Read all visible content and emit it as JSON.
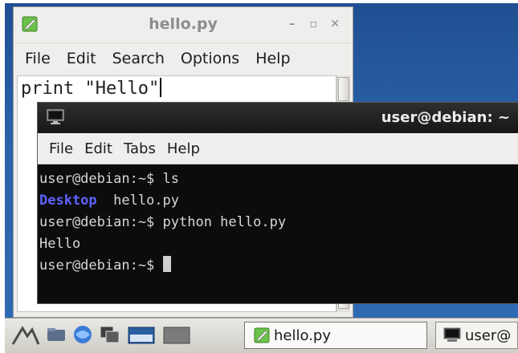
{
  "editor": {
    "title": "hello.py",
    "menu": [
      "File",
      "Edit",
      "Search",
      "Options",
      "Help"
    ],
    "content": "print \"Hello\"",
    "window_buttons": [
      "–",
      "▫",
      "✕"
    ]
  },
  "terminal": {
    "title": "user@debian: ~",
    "menu": [
      "File",
      "Edit",
      "Tabs",
      "Help"
    ],
    "lines": [
      {
        "prompt": "user@debian:~$ ",
        "cmd": "ls"
      },
      {
        "dir": "Desktop",
        "file": "  hello.py"
      },
      {
        "prompt": "user@debian:~$ ",
        "cmd": "python hello.py"
      },
      {
        "output": "Hello"
      },
      {
        "prompt": "user@debian:~$ ",
        "cmd": ""
      }
    ]
  },
  "taskbar": {
    "tasks": [
      "hello.py",
      "user@"
    ]
  },
  "colors": {
    "desktop": "#2b63a8",
    "terminal_bg": "#0c0c0c",
    "dir": "#5e63ff"
  }
}
